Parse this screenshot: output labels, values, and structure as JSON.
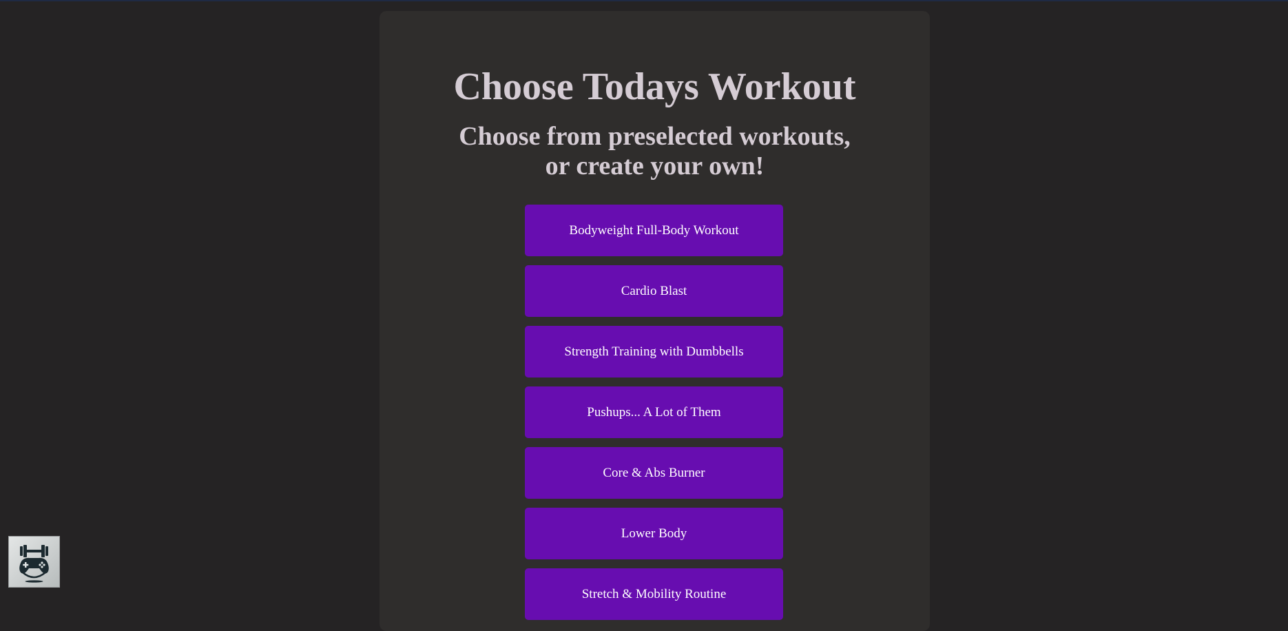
{
  "page": {
    "title": "Choose Todays Workout",
    "subtitle_line1": "Choose from preselected workouts,",
    "subtitle_line2": "or create your own!"
  },
  "workouts": [
    {
      "label": "Bodyweight Full-Body Workout"
    },
    {
      "label": "Cardio Blast"
    },
    {
      "label": "Strength Training with Dumbbells"
    },
    {
      "label": "Pushups... A Lot of Them"
    },
    {
      "label": "Core & Abs Burner"
    },
    {
      "label": "Lower Body"
    },
    {
      "label": "Stretch & Mobility Routine"
    }
  ],
  "app_icon": {
    "name": "dumbbell-gamepad-icon"
  },
  "colors": {
    "background": "#252324",
    "panel": "#2f2d2c",
    "heading_text": "#d5ccd4",
    "button_bg": "#670db0",
    "button_text": "#ffffff"
  }
}
